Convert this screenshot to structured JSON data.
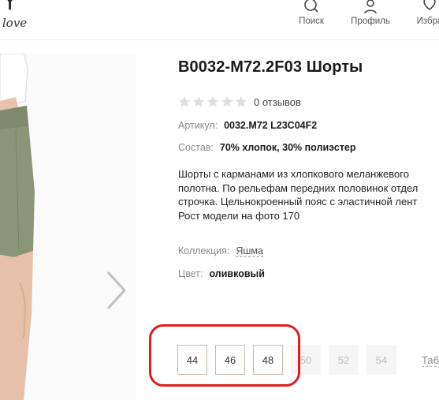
{
  "header": {
    "logo_letter": "Y",
    "logo_word": "love",
    "nav": {
      "search_label": "Поиск",
      "profile_label": "Профиль",
      "favorites_label": "Избра"
    }
  },
  "product": {
    "title": "B0032-M72.2F03 Шорты",
    "rating_value": 0,
    "rating_max": 5,
    "reviews_text": "0 отзывов",
    "article_label": "Артикул:",
    "article_value": "0032.M72 L23C04F2",
    "composition_label": "Состав:",
    "composition_value": "70% хлопок, 30% полиэстер",
    "description_lines": [
      "Шорты с карманами из хлопкового меланжевого",
      "полотна. По рельефам передних половинок отдел",
      "строчка. Цельнокроенный пояс с эластичной лент",
      "Рост модели на фото 170"
    ],
    "collection_label": "Коллекция:",
    "collection_value": "Яшма",
    "color_label": "Цвет:",
    "color_value": "оливковый"
  },
  "sizes": [
    {
      "label": "44",
      "available": true
    },
    {
      "label": "46",
      "available": true
    },
    {
      "label": "48",
      "available": true
    },
    {
      "label": "50",
      "available": false
    },
    {
      "label": "52",
      "available": false
    },
    {
      "label": "54",
      "available": false
    }
  ],
  "size_table_label": "Табл",
  "colors": {
    "highlight": "#e01e1e",
    "size_border": "#c9b8aa",
    "unavailable_bg": "#f5f5f5",
    "shorts": "#8a9677"
  }
}
